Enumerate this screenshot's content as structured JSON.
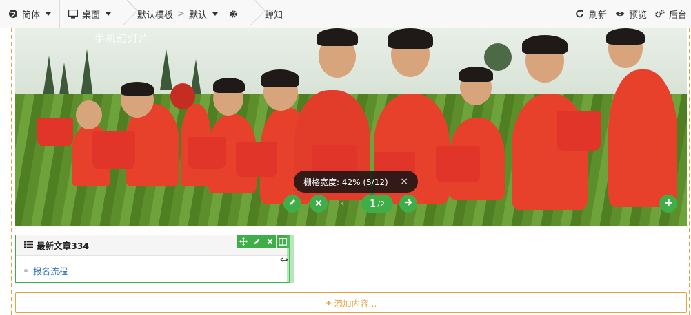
{
  "toolbar": {
    "language": "简体",
    "device": "桌面",
    "template": "默认模板",
    "layout": "默认",
    "page": "蝉知",
    "refresh": "刷新",
    "preview": "预览",
    "admin": "后台"
  },
  "slider": {
    "watermark": "手机幻灯片",
    "grid_tip": "栅格宽度: 42% (5/12)",
    "grid_tip_close": "×",
    "pager_current": "1",
    "pager_total": "/2"
  },
  "module": {
    "title": "最新文章334",
    "items": [
      {
        "label": "报名流程"
      }
    ]
  },
  "add_content": "添加内容..."
}
